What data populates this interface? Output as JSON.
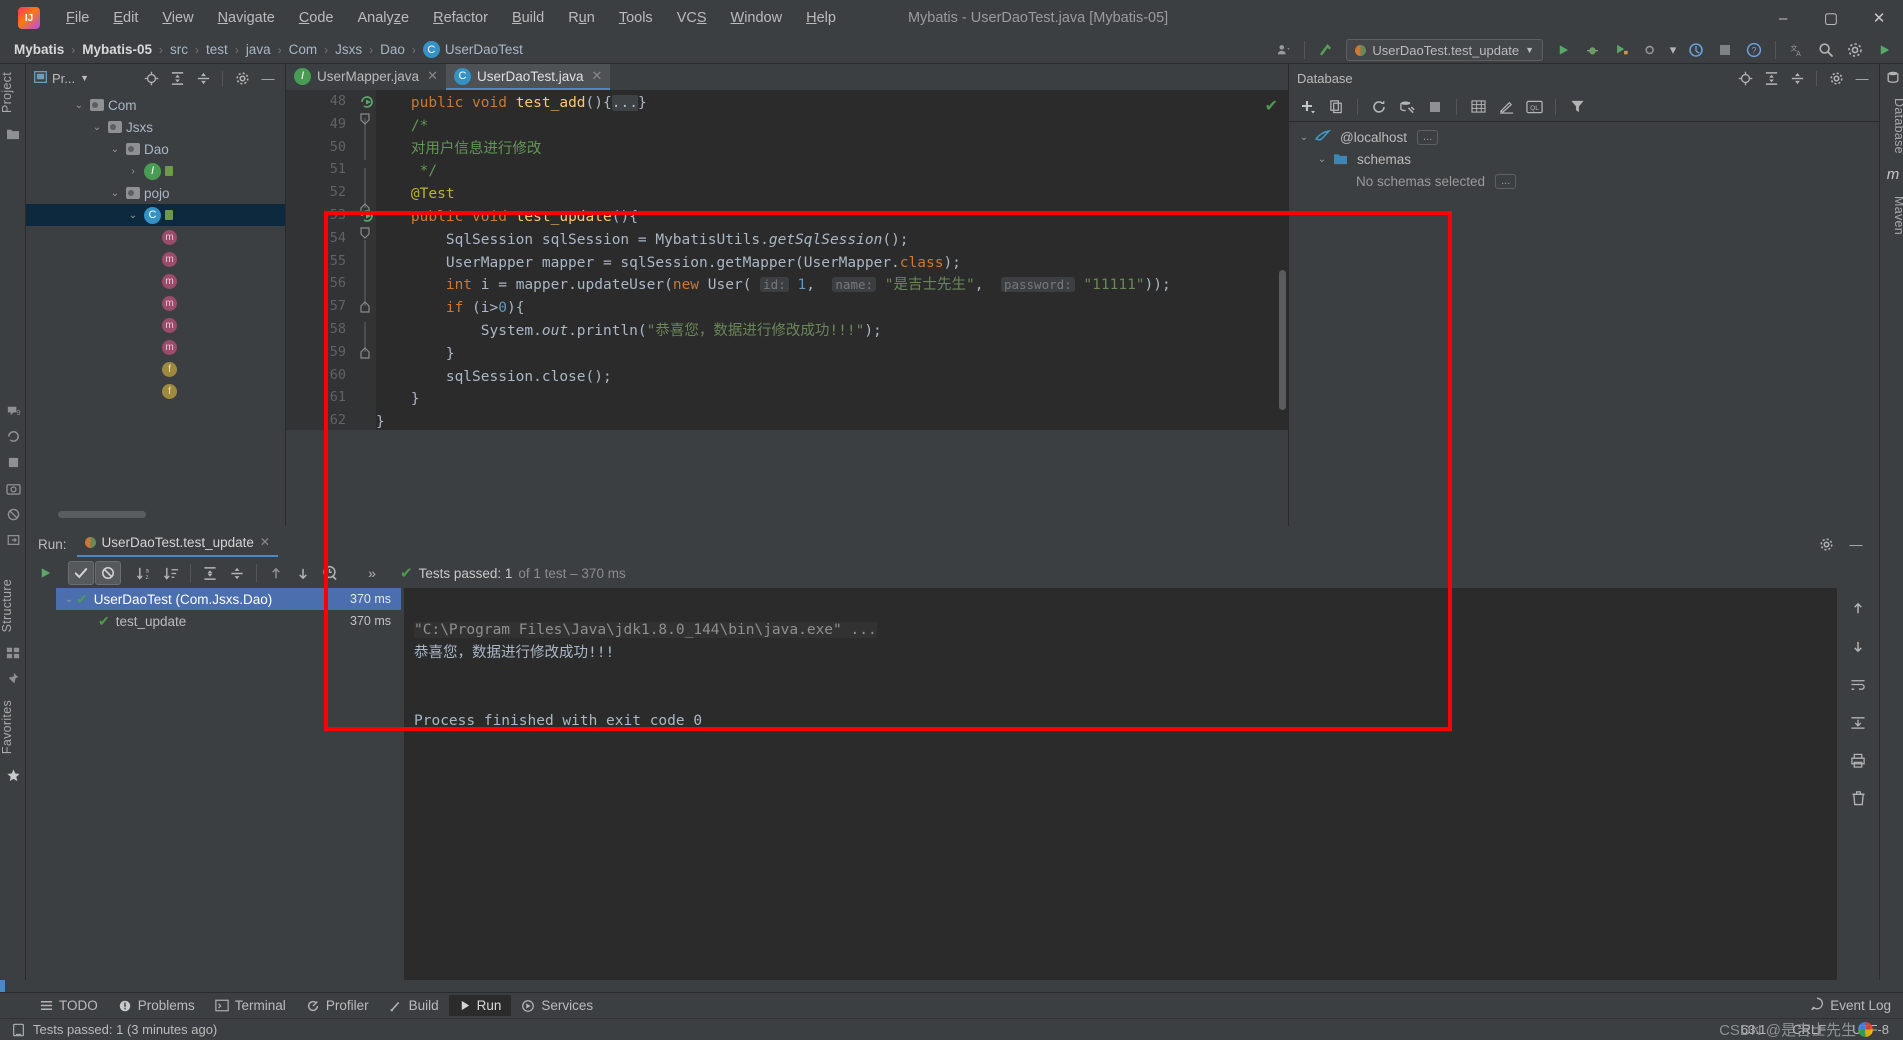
{
  "window": {
    "title": "Mybatis - UserDaoTest.java [Mybatis-05]",
    "minimize": "–",
    "maximize": "▢",
    "close": "✕"
  },
  "menubar": [
    {
      "label": "File",
      "mnemonic": "F"
    },
    {
      "label": "Edit",
      "mnemonic": "E"
    },
    {
      "label": "View",
      "mnemonic": "V"
    },
    {
      "label": "Navigate",
      "mnemonic": "N"
    },
    {
      "label": "Code",
      "mnemonic": "C"
    },
    {
      "label": "Analyze",
      "mnemonic": "z"
    },
    {
      "label": "Refactor",
      "mnemonic": "R"
    },
    {
      "label": "Build",
      "mnemonic": "B"
    },
    {
      "label": "Run",
      "mnemonic": "u"
    },
    {
      "label": "Tools",
      "mnemonic": "T"
    },
    {
      "label": "VCS",
      "mnemonic": "S"
    },
    {
      "label": "Window",
      "mnemonic": "W"
    },
    {
      "label": "Help",
      "mnemonic": "H"
    }
  ],
  "breadcrumb": {
    "items": [
      "Mybatis",
      "Mybatis-05",
      "src",
      "test",
      "java",
      "Com",
      "Jsxs",
      "Dao",
      "UserDaoTest"
    ],
    "separator": "›",
    "leaf_icon": "class-icon"
  },
  "toolbar": {
    "run_config": "UserDaoTest.test_update",
    "dropdown_caret": "▼",
    "run": "▶",
    "debug": "debug-icon",
    "run_coverage": "coverage-icon",
    "profile_caret": "▼",
    "help": "?",
    "stop": "■",
    "search": "search-icon",
    "settings": "gear-icon",
    "translate": "translate-icon",
    "user": "user-icon",
    "updates": "vcs-update-icon"
  },
  "left_strip": {
    "project_tab": "Project",
    "structure_tab": "Structure",
    "favorites_tab": "Favorites"
  },
  "right_strip": {
    "database_tab": "Database",
    "maven_tab": "Maven",
    "m_tab": "m"
  },
  "project_panel": {
    "title": "Pr...",
    "caret": "▼",
    "icons": [
      "locate-icon",
      "collapse-all-icon",
      "expand-all-icon",
      "gear-icon",
      "hide-icon"
    ],
    "tree": [
      {
        "label": "Com",
        "type": "folder",
        "depth": 2,
        "chevron": "⌄"
      },
      {
        "label": "Jsxs",
        "type": "folder",
        "depth": 3,
        "chevron": "⌄"
      },
      {
        "label": "Dao",
        "type": "folder",
        "depth": 4,
        "chevron": "⌄"
      },
      {
        "label": "",
        "type": "interface",
        "depth": 5,
        "chevron": "›"
      },
      {
        "label": "pojo",
        "type": "folder",
        "depth": 4,
        "chevron": "⌄"
      },
      {
        "label": "",
        "type": "class",
        "depth": 5,
        "chevron": "⌄",
        "selected": true
      },
      {
        "label": "",
        "type": "method",
        "depth": 6
      },
      {
        "label": "",
        "type": "method",
        "depth": 6
      },
      {
        "label": "",
        "type": "method",
        "depth": 6
      },
      {
        "label": "",
        "type": "method",
        "depth": 6
      },
      {
        "label": "",
        "type": "method",
        "depth": 6
      },
      {
        "label": "",
        "type": "method",
        "depth": 6
      },
      {
        "label": "",
        "type": "field",
        "depth": 6
      },
      {
        "label": "",
        "type": "field",
        "depth": 6
      }
    ]
  },
  "editor": {
    "tabs": [
      {
        "label": "UserMapper.java",
        "icon": "interface-icon",
        "active": false,
        "close": "✕"
      },
      {
        "label": "UserDaoTest.java",
        "icon": "class-icon",
        "active": true,
        "close": "✕"
      }
    ],
    "inspection_ok": "✔",
    "lines": [
      {
        "n": 48,
        "html": "    <k>public</k> <k>void</k> <m>test_add</m>(){<f>...</f>}"
      },
      {
        "n": 49,
        "html": "    <c>/*</c>"
      },
      {
        "n": 50,
        "html": "    <c>对用户信息进行修改</c>"
      },
      {
        "n": 51,
        "html": "     <c>*/</c>"
      },
      {
        "n": 52,
        "html": "    <a>@Test</a>"
      },
      {
        "n": 53,
        "html": "    <k>public</k> <k>void</k> <m>test_update</m>(){"
      },
      {
        "n": 54,
        "html": "        SqlSession sqlSession = MybatisUtils.<i>getSqlSession</i>();"
      },
      {
        "n": 55,
        "html": "        UserMapper mapper = sqlSession.getMapper(UserMapper.<k>class</k>);"
      },
      {
        "n": 56,
        "html": "        <k>int</k> i = mapper.updateUser(<k>new</k> User( <h>id:</h> <n>1</n>,  <h>name:</h> <s>\"是吉士先生\"</s>,  <h>password:</h> <s>\"11111\"</s>));"
      },
      {
        "n": 57,
        "html": "        <k>if</k> (i&gt;<n>0</n>){"
      },
      {
        "n": 58,
        "html": "            System.<i>out</i>.println(<s>\"恭喜您，数据进行修改成功!!!\"</s>);"
      },
      {
        "n": 59,
        "html": "        }"
      },
      {
        "n": 60,
        "html": "        sqlSession.close();"
      },
      {
        "n": 61,
        "html": "    }"
      },
      {
        "n": 62,
        "html": "}"
      }
    ]
  },
  "database_panel": {
    "title": "Database",
    "head_icons": [
      "locate-icon",
      "collapse-all-icon",
      "expand-all-icon",
      "gear-icon",
      "hide-icon"
    ],
    "toolbar_icons": [
      "add-icon",
      "copy-icon",
      "refresh-icon",
      "datasource-properties-icon",
      "stop-icon",
      "table-icon",
      "edit-icon",
      "query-console-icon",
      "filter-icon"
    ],
    "tree": [
      {
        "label": "@localhost",
        "chevron": "⌄",
        "icon": "mysql-icon",
        "dots": "..."
      },
      {
        "label": "schemas",
        "chevron": "⌄",
        "icon": "folder-icon"
      },
      {
        "label": "No schemas selected",
        "icon": "none",
        "dots": "..."
      }
    ]
  },
  "run_panel": {
    "label": "Run:",
    "tab": "UserDaoTest.test_update",
    "tab_close": "✕",
    "toolbar": {
      "rerun": "▶",
      "show_passed": "✔",
      "show_ignored": "⊘",
      "sort_alpha": "↓az",
      "sort_duration": "↓≡",
      "expand_all": "⤓",
      "collapse_all": "⤒",
      "prev_fail": "↑",
      "next_fail": "↓",
      "history": "⏱",
      "more": "»"
    },
    "status": {
      "check": "✔",
      "main": "Tests passed: 1",
      "detail": "of 1 test – 370 ms"
    },
    "tree": [
      {
        "label": "UserDaoTest (Com.Jsxs.Dao)",
        "time": "370 ms",
        "chevron": "⌄",
        "status": "✔",
        "selected": true,
        "depth": 0
      },
      {
        "label": "test_update",
        "time": "370 ms",
        "status": "✔",
        "selected": false,
        "depth": 1
      }
    ],
    "console": {
      "command": "\"C:\\Program Files\\Java\\jdk1.8.0_144\\bin\\java.exe\" ...",
      "output": "恭喜您，数据进行修改成功!!!",
      "blank": "",
      "exit": "Process finished with exit code 0"
    },
    "side_icons": [
      "scroll-up-icon",
      "scroll-down-icon",
      "soft-wrap-icon",
      "scroll-to-end-icon",
      "print-icon",
      "clear-all-icon"
    ]
  },
  "bottom_bar": {
    "items": [
      {
        "label": "TODO",
        "icon": "todo-icon",
        "active": false
      },
      {
        "label": "Problems",
        "icon": "problems-icon",
        "active": false
      },
      {
        "label": "Terminal",
        "icon": "terminal-icon",
        "active": false
      },
      {
        "label": "Profiler",
        "icon": "profiler-icon",
        "active": false
      },
      {
        "label": "Build",
        "icon": "build-icon",
        "active": false
      },
      {
        "label": "Run",
        "icon": "run-icon",
        "active": true
      },
      {
        "label": "Services",
        "icon": "services-icon",
        "active": false
      }
    ],
    "event_log": "Event Log",
    "event_log_icon": "balloon-icon"
  },
  "status_bar": {
    "message": "Tests passed: 1 (3 minutes ago)",
    "message_icon": "test-icon",
    "caret_position": "63:1",
    "line_separator": "CRLF",
    "encoding": "UTF-8",
    "watermark": "CSDN @是吉士先生"
  },
  "colors": {
    "accent_blue": "#4a88c7",
    "selection_blue": "#4b6eaf",
    "annotation_red": "#fb0007",
    "pass_green": "#4e9a4e",
    "panel_bg": "#3c3f41",
    "editor_bg": "#2b2b2b"
  }
}
